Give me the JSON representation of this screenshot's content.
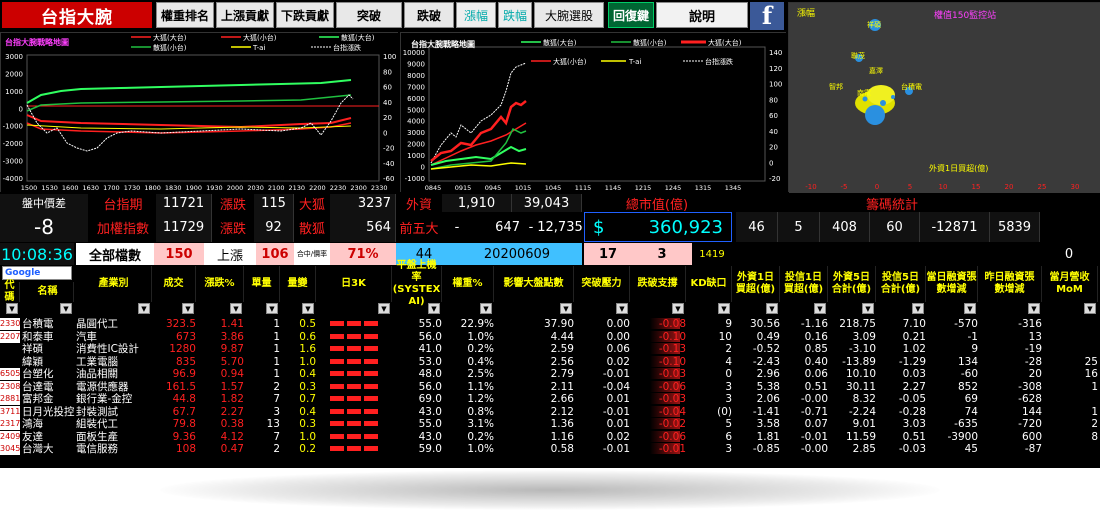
{
  "app": {
    "title": "台指大腕"
  },
  "toolbar": [
    "權重排名",
    "上漲貢獻",
    "下跌貢獻",
    "突破",
    "跌破",
    "漲幅",
    "跌幅",
    "大腕選股",
    "回復鍵",
    "說明"
  ],
  "fb_icon": "facebook-icon",
  "chart1": {
    "title": "台指大腕戰略地圖",
    "legend": [
      "大狐(大台)",
      "大狐(小台)",
      "散狐(大台)",
      "散狐(小台)",
      "T-ai",
      "台指漲跌"
    ],
    "yleft": [
      "3000",
      "2000",
      "1000",
      "0",
      "-1000",
      "-2000",
      "-3000",
      "-4000"
    ],
    "yright": [
      "100",
      "80",
      "60",
      "40",
      "20",
      "0",
      "-20",
      "-40",
      "-60"
    ],
    "xticks": [
      "1500",
      "1530",
      "1600",
      "1630",
      "1700",
      "1730",
      "1800",
      "1830",
      "1900",
      "1930",
      "2000",
      "2030",
      "2100",
      "2130",
      "2200",
      "2230",
      "2300",
      "2330"
    ]
  },
  "chart2": {
    "title": "台指大腕戰略地圖",
    "legend": [
      "散狐(大台)",
      "散狐(小台)",
      "大狐(大台)",
      "大狐(小台)",
      "T-ai",
      "台指漲跌"
    ],
    "yleft": [
      "10000",
      "9000",
      "8000",
      "7000",
      "6000",
      "5000",
      "4000",
      "3000",
      "2000",
      "1000",
      "0",
      "-1000"
    ],
    "yright": [
      "140",
      "120",
      "100",
      "80",
      "60",
      "40",
      "20",
      "0",
      "-20"
    ],
    "xticks": [
      "0845",
      "0915",
      "0945",
      "1015",
      "1045",
      "1115",
      "1145",
      "1215",
      "1245",
      "1315",
      "1345"
    ]
  },
  "chart3": {
    "title_left": "漲幅",
    "title_right": "權值150監控站",
    "xlabel": "外資1日買超(億)",
    "xticks": [
      "-10",
      "-5",
      "0",
      "5",
      "10",
      "15",
      "20",
      "25",
      "30"
    ],
    "labels": [
      "祥碩",
      "聯茂",
      "台積電",
      "嘉澤",
      "智邦",
      "南電"
    ]
  },
  "info": {
    "row1": {
      "label": "盤中價差",
      "c1": "台指期",
      "c1v": "11721",
      "c2": "漲跌",
      "c2v": "115",
      "c3": "大狐",
      "c3v": "3237",
      "c4": "外資",
      "c4a": "1,910",
      "c4b": "39,043",
      "c5": "總市值(億)",
      "c6": "籌碼統計"
    },
    "row2": {
      "spread": "-8",
      "c1": "加權指數",
      "c1v": "11729",
      "c2": "漲跌",
      "c2v": "92",
      "c3": "散狐",
      "c3v": "564",
      "c4": "前五大",
      "dash1": "-",
      "c4a": "647",
      "dash2": "-",
      "c4b": "12,735",
      "cur": "$",
      "mkt": "360,923",
      "s1": "46",
      "s2": "5",
      "s3": "408",
      "s4": "60",
      "s5": "-12871",
      "s6": "5839"
    },
    "row3": {
      "time": "10:08:36",
      "c1": "全部檔數",
      "c1v": "150",
      "c2": "上漲",
      "c2v": "106",
      "c3": "合中/價率",
      "c3v": "71%",
      "c4": "44",
      "date": "20200609",
      "a": "17",
      "b": "3",
      "k": "1419",
      "z": "0"
    }
  },
  "search_label": "Google",
  "headers": [
    "代碼",
    "名稱",
    "產業別",
    "成交",
    "漲跌%",
    "單量",
    "量變",
    "日3K",
    "平盤上機率\n(SYSTEX AI)",
    "權重%",
    "影響大盤點數",
    "突破壓力",
    "跌破支撐",
    "KD缺口",
    "外資1日\n買超(億)",
    "投信1日\n買超(億)",
    "外資5日\n合計(億)",
    "投信5日\n合計(億)",
    "當日融資張\n數增減",
    "昨日融資張\n數增減",
    "當月營收\nMoM"
  ],
  "rows": [
    {
      "code": "2330",
      "name": "台積電",
      "ind": "晶圓代工",
      "price": "323.5",
      "chg": "1.41",
      "vol": "1",
      "vr": "0.5",
      "prob": "55.0",
      "w": "22.9%",
      "pts": "37.90",
      "br": "0.00",
      "bd": "-0.08",
      "kd": "9",
      "f1": "30.56",
      "t1": "-1.16",
      "f5": "218.75",
      "t5": "7.10",
      "m1": "-570",
      "m2": "-316",
      "mom": ""
    },
    {
      "code": "2207",
      "name": "和泰車",
      "ind": "汽車",
      "price": "673",
      "chg": "3.86",
      "vol": "1",
      "vr": "0.6",
      "prob": "56.0",
      "w": "1.0%",
      "pts": "4.44",
      "br": "0.00",
      "bd": "-0.10",
      "kd": "10",
      "f1": "0.49",
      "t1": "0.16",
      "f5": "3.09",
      "t5": "0.21",
      "m1": "-1",
      "m2": "13",
      "mom": ""
    },
    {
      "code": "",
      "name": "祥碩",
      "ind": "消費性IC設計",
      "price": "1280",
      "chg": "9.87",
      "vol": "1",
      "vr": "1.6",
      "prob": "41.0",
      "w": "0.2%",
      "pts": "2.59",
      "br": "0.06",
      "bd": "-0.13",
      "kd": "2",
      "f1": "-0.52",
      "t1": "0.85",
      "f5": "-3.10",
      "t5": "1.02",
      "m1": "9",
      "m2": "-19",
      "mom": ""
    },
    {
      "code": "",
      "name": "緯穎",
      "ind": "工業電腦",
      "price": "835",
      "chg": "5.70",
      "vol": "1",
      "vr": "1.0",
      "prob": "53.0",
      "w": "0.4%",
      "pts": "2.56",
      "br": "0.02",
      "bd": "-0.10",
      "kd": "4",
      "f1": "-2.43",
      "t1": "0.40",
      "f5": "-13.89",
      "t5": "-1.29",
      "m1": "134",
      "m2": "-28",
      "mom": "25"
    },
    {
      "code": "6505",
      "name": "台塑化",
      "ind": "油品相關",
      "price": "96.9",
      "chg": "0.94",
      "vol": "1",
      "vr": "0.4",
      "prob": "48.0",
      "w": "2.5%",
      "pts": "2.79",
      "br": "-0.01",
      "bd": "-0.03",
      "kd": "0",
      "f1": "2.96",
      "t1": "0.06",
      "f5": "10.10",
      "t5": "0.03",
      "m1": "-60",
      "m2": "20",
      "mom": "16"
    },
    {
      "code": "2308",
      "name": "台達電",
      "ind": "電源供應器",
      "price": "161.5",
      "chg": "1.57",
      "vol": "2",
      "vr": "0.3",
      "prob": "56.0",
      "w": "1.1%",
      "pts": "2.11",
      "br": "-0.04",
      "bd": "-0.06",
      "kd": "3",
      "f1": "5.38",
      "t1": "0.51",
      "f5": "30.11",
      "t5": "2.27",
      "m1": "852",
      "m2": "-308",
      "mom": "1"
    },
    {
      "code": "2881",
      "name": "富邦金",
      "ind": "銀行業-金控",
      "price": "44.8",
      "chg": "1.82",
      "vol": "7",
      "vr": "0.7",
      "prob": "69.0",
      "w": "1.2%",
      "pts": "2.66",
      "br": "0.01",
      "bd": "-0.03",
      "kd": "3",
      "f1": "2.06",
      "t1": "-0.00",
      "f5": "8.32",
      "t5": "-0.05",
      "m1": "69",
      "m2": "-628",
      "mom": ""
    },
    {
      "code": "3711",
      "name": "日月光投控",
      "ind": "封裝測試",
      "price": "67.7",
      "chg": "2.27",
      "vol": "3",
      "vr": "0.4",
      "prob": "43.0",
      "w": "0.8%",
      "pts": "2.12",
      "br": "-0.01",
      "bd": "-0.04",
      "kd": "(0)",
      "f1": "-1.41",
      "t1": "-0.71",
      "f5": "-2.24",
      "t5": "-0.28",
      "m1": "74",
      "m2": "144",
      "mom": "1"
    },
    {
      "code": "2317",
      "name": "鴻海",
      "ind": "組裝代工",
      "price": "79.8",
      "chg": "0.38",
      "vol": "13",
      "vr": "0.3",
      "prob": "55.0",
      "w": "3.1%",
      "pts": "1.36",
      "br": "0.01",
      "bd": "-0.02",
      "kd": "5",
      "f1": "3.58",
      "t1": "0.07",
      "f5": "9.01",
      "t5": "3.03",
      "m1": "-635",
      "m2": "-720",
      "mom": "2"
    },
    {
      "code": "2409",
      "name": "友達",
      "ind": "面板生產",
      "price": "9.36",
      "chg": "4.12",
      "vol": "7",
      "vr": "1.0",
      "prob": "43.0",
      "w": "0.2%",
      "pts": "1.16",
      "br": "0.02",
      "bd": "-0.06",
      "kd": "6",
      "f1": "1.81",
      "t1": "-0.01",
      "f5": "11.59",
      "t5": "0.51",
      "m1": "-3900",
      "m2": "600",
      "mom": "8"
    },
    {
      "code": "3045",
      "name": "台灣大",
      "ind": "電信服務",
      "price": "108",
      "chg": "0.47",
      "vol": "2",
      "vr": "0.2",
      "prob": "59.0",
      "w": "1.0%",
      "pts": "0.58",
      "br": "-0.01",
      "bd": "-0.01",
      "kd": "3",
      "f1": "-0.85",
      "t1": "-0.00",
      "f5": "2.85",
      "t5": "-0.03",
      "m1": "45",
      "m2": "-87",
      "mom": ""
    }
  ],
  "colors": {
    "red": "#ff2020",
    "green": "#00e060",
    "yellow": "#ffff00",
    "cyan": "#00ffff",
    "blue": "#2060ff"
  }
}
